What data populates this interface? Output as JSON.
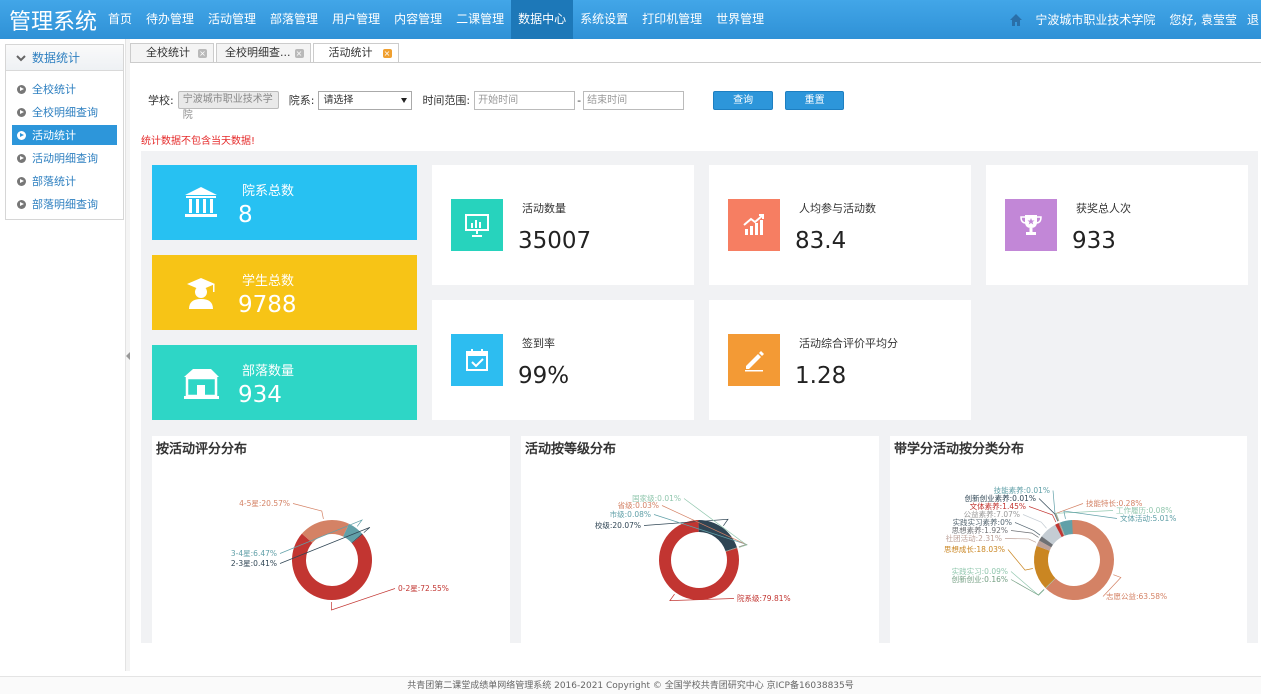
{
  "app": {
    "title": "管理系统"
  },
  "nav": {
    "items": [
      {
        "label": "首页"
      },
      {
        "label": "待办管理"
      },
      {
        "label": "活动管理"
      },
      {
        "label": "部落管理"
      },
      {
        "label": "用户管理"
      },
      {
        "label": "内容管理"
      },
      {
        "label": "二课管理"
      },
      {
        "label": "数据中心",
        "active": true
      },
      {
        "label": "系统设置"
      },
      {
        "label": "打印机管理"
      },
      {
        "label": "世界管理"
      }
    ],
    "school": "宁波城市职业技术学院",
    "greeting": "您好, 袁莹莹",
    "logout_partial": "退"
  },
  "sidebar": {
    "header": "数据统计",
    "items": [
      {
        "label": "全校统计"
      },
      {
        "label": "全校明细查询"
      },
      {
        "label": "活动统计",
        "active": true
      },
      {
        "label": "活动明细查询"
      },
      {
        "label": "部落统计"
      },
      {
        "label": "部落明细查询"
      }
    ]
  },
  "tabs": [
    {
      "label": "全校统计"
    },
    {
      "label": "全校明细查..."
    },
    {
      "label": "活动统计",
      "active": true
    }
  ],
  "filter": {
    "school_label": "学校:",
    "school_value": "宁波城市职业技术学院",
    "dept_label": "院系:",
    "dept_value": "请选择",
    "range_label": "时间范围:",
    "start_placeholder": "开始时间",
    "end_placeholder": "结束时间",
    "dash": "-",
    "query_btn": "查询",
    "reset_btn": "重置"
  },
  "notice": "统计数据不包含当天数据!",
  "bigcards": [
    {
      "label": "院系总数",
      "value": "8",
      "color": "#27c1f2",
      "icon": "institution-icon"
    },
    {
      "label": "学生总数",
      "value": "9788",
      "color": "#f7c416",
      "icon": "graduate-icon"
    },
    {
      "label": "部落数量",
      "value": "934",
      "color": "#2ed6c6",
      "icon": "tribe-house-icon"
    }
  ],
  "stats": [
    {
      "label": "活动数量",
      "value": "35007",
      "color": "#27d3bd",
      "icon": "presentation-icon"
    },
    {
      "label": "人均参与活动数",
      "value": "83.4",
      "color": "#f67e62",
      "icon": "trend-chart-icon"
    },
    {
      "label": "获奖总人次",
      "value": "933",
      "color": "#c287d7",
      "icon": "trophy-icon"
    },
    {
      "label": "签到率",
      "value": "99%",
      "color": "#2dbdf0",
      "icon": "calendar-check-icon"
    },
    {
      "label": "活动综合评价平均分",
      "value": "1.28",
      "color": "#f39a35",
      "icon": "pencil-icon"
    }
  ],
  "chart_data": [
    {
      "type": "pie",
      "title": "按活动评分分布",
      "labels": [
        "0-2星",
        "4-5星",
        "3-4星",
        "2-3星"
      ],
      "values": [
        72.55,
        20.57,
        6.47,
        0.41
      ],
      "colors": [
        "#c23531",
        "#d48265",
        "#61a0a8",
        "#2f4554"
      ],
      "display": [
        "0-2星:72.55%",
        "4-5星:20.57%",
        "3-4星:6.47%",
        "2-3星:0.41%"
      ]
    },
    {
      "type": "pie",
      "title": "活动按等级分布",
      "labels": [
        "院系级",
        "校级",
        "市级",
        "省级",
        "国家级"
      ],
      "values": [
        79.81,
        20.07,
        0.08,
        0.03,
        0.01
      ],
      "colors": [
        "#c23531",
        "#2f4554",
        "#61a0a8",
        "#d48265",
        "#91c7ae"
      ],
      "display": [
        "院系级:79.81%",
        "校级:20.07%",
        "市级:0.08%",
        "省级:0.03%",
        "国家级:0.01%"
      ]
    },
    {
      "type": "pie",
      "title": "带学分活动按分类分布",
      "labels": [
        "志愿公益",
        "实践实习",
        "创新创业",
        "思想成长",
        "社团活动",
        "思想素养",
        "实践实习素养",
        "公益素养",
        "文体素养",
        "创新创业素养",
        "技能素养",
        "技能特长",
        "工作履历",
        "文体活动"
      ],
      "values": [
        63.58,
        0.09,
        0.16,
        18.03,
        2.31,
        1.92,
        0,
        7.07,
        1.45,
        0.01,
        0.01,
        0.28,
        0.08,
        5.01
      ],
      "colors": [
        "#d48265",
        "#91c7ae",
        "#749f83",
        "#ca8622",
        "#bda29a",
        "#6e7074",
        "#546570",
        "#c4ccd3",
        "#c23531",
        "#2f4554",
        "#61a0a8",
        "#d48265",
        "#91c7ae",
        "#61a0a8"
      ],
      "display": [
        "志愿公益:63.58%",
        "实践实习:0.09%",
        "创新创业:0.16%",
        "思想成长:18.03%",
        "社团活动:2.31%",
        "思想素养:1.92%",
        "实践实习素养:0%",
        "公益素养:7.07%",
        "文体素养:1.45%",
        "创新创业素养:0.01%",
        "技能素养:0.01%",
        "技能特长:0.28%",
        "工作履历:0.08%",
        "文体活动:5.01%"
      ]
    }
  ],
  "footer": "共青团第二课堂成绩单网络管理系统      2016-2021 Copyright © 全国学校共青团研究中心  京ICP备16038835号"
}
